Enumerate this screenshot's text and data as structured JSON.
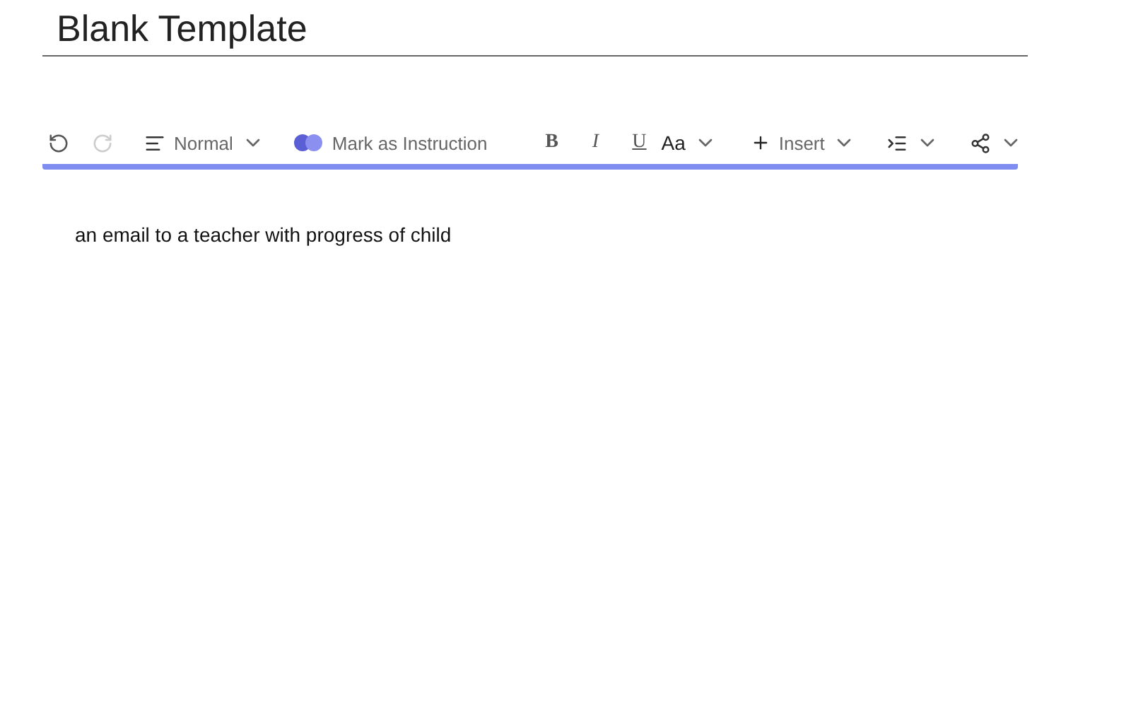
{
  "title": "Blank Template",
  "toolbar": {
    "undo": {
      "disabled": false
    },
    "redo": {
      "disabled": true
    },
    "style": {
      "label": "Normal"
    },
    "instruction": {
      "label": "Mark as Instruction"
    },
    "format": [
      {
        "kind": "bold",
        "label": "B"
      },
      {
        "kind": "italic",
        "label": "I"
      },
      {
        "kind": "underline",
        "label": "U"
      }
    ],
    "font_size": {
      "label": "Aa"
    },
    "insert": {
      "label": "Insert"
    }
  },
  "body": "an email to a teacher with progress of child"
}
